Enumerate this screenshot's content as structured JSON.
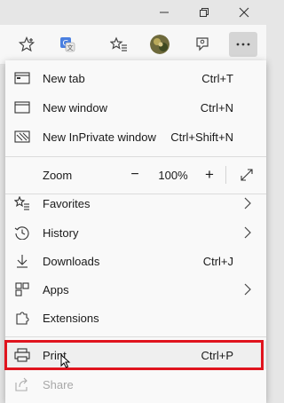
{
  "window": {
    "buttons": [
      {
        "name": "minimize",
        "icon": "minimize-icon"
      },
      {
        "name": "restore",
        "icon": "restore-icon"
      },
      {
        "name": "close",
        "icon": "close-icon"
      }
    ]
  },
  "toolbar": {
    "icons": [
      "favorite-star-icon",
      "translate-icon",
      "favorites-list-icon",
      "profile-avatar",
      "feedback-icon",
      "more-options-icon"
    ]
  },
  "menu": {
    "items": [
      {
        "label": "New tab",
        "shortcut": "Ctrl+T",
        "icon": "new-tab-icon"
      },
      {
        "label": "New window",
        "shortcut": "Ctrl+N",
        "icon": "new-window-icon"
      },
      {
        "label": "New InPrivate window",
        "shortcut": "Ctrl+Shift+N",
        "icon": "inprivate-icon"
      }
    ],
    "zoom": {
      "label": "Zoom",
      "minus": "−",
      "value": "100%",
      "plus": "+",
      "icon": "fullscreen-icon"
    },
    "items2": [
      {
        "label": "Favorites",
        "icon": "favorites-icon",
        "submenu": true
      },
      {
        "label": "History",
        "icon": "history-icon",
        "submenu": true
      },
      {
        "label": "Downloads",
        "shortcut": "Ctrl+J",
        "icon": "download-icon"
      },
      {
        "label": "Apps",
        "icon": "apps-icon",
        "submenu": true
      },
      {
        "label": "Extensions",
        "icon": "extensions-icon"
      }
    ],
    "print": {
      "label": "Print",
      "shortcut": "Ctrl+P",
      "icon": "print-icon",
      "highlighted": true
    },
    "share": {
      "label": "Share",
      "icon": "share-icon",
      "disabled": true
    }
  },
  "colors": {
    "highlight_border": "#e0141e",
    "menu_bg": "#f9f9f9",
    "titlebar_bg": "#e6e6e6"
  }
}
